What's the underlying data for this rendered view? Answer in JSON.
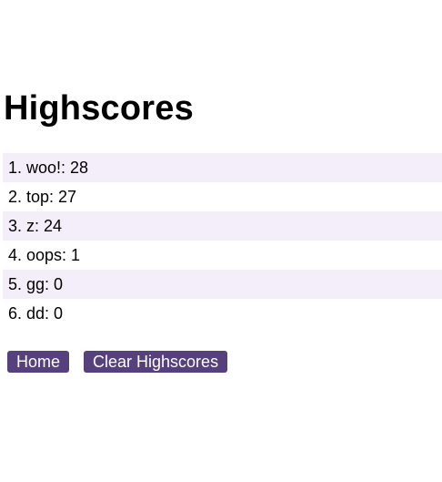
{
  "page": {
    "title": "Highscores"
  },
  "scores": [
    {
      "text": "1. woo!: 28"
    },
    {
      "text": "2. top: 27"
    },
    {
      "text": "3. z: 24"
    },
    {
      "text": "4. oops: 1"
    },
    {
      "text": "5. gg: 0"
    },
    {
      "text": "6. dd: 0"
    }
  ],
  "buttons": {
    "home_label": "Home",
    "clear_label": "Clear Highscores"
  },
  "colors": {
    "accent": "#56407e",
    "row_highlight": "#f3eefa"
  }
}
